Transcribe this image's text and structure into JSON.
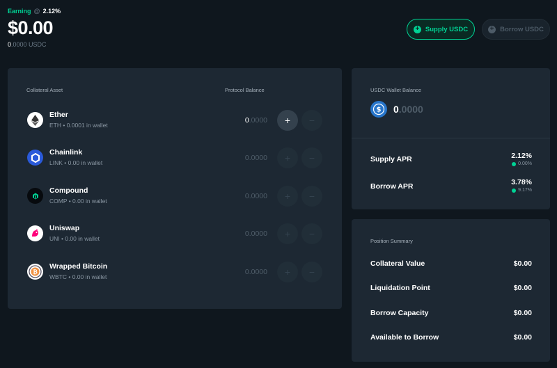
{
  "header": {
    "earning_label": "Earning",
    "earning_at": "@",
    "earning_rate": "2.12%",
    "balance": "$0.00",
    "balance_sub_lead": "0",
    "balance_sub_rest": ".0000 USDC"
  },
  "actions": {
    "supply_label": "Supply USDC",
    "borrow_label": "Borrow USDC"
  },
  "collateral": {
    "col_asset": "Collateral Asset",
    "col_balance": "Protocol Balance",
    "assets": [
      {
        "name": "Ether",
        "sub": "ETH • 0.0001 in wallet",
        "bal_lead": "0",
        "bal_rest": ".0000",
        "color": "#ffffff"
      },
      {
        "name": "Chainlink",
        "sub": "LINK • 0.00 in wallet",
        "bal_lead": "",
        "bal_rest": "0.0000",
        "color": "#2a5ada"
      },
      {
        "name": "Compound",
        "sub": "COMP • 0.00 in wallet",
        "bal_lead": "",
        "bal_rest": "0.0000",
        "color": "#070a0e"
      },
      {
        "name": "Uniswap",
        "sub": "UNI • 0.00 in wallet",
        "bal_lead": "",
        "bal_rest": "0.0000",
        "color": "#ffffff"
      },
      {
        "name": "Wrapped Bitcoin",
        "sub": "WBTC • 0.00 in wallet",
        "bal_lead": "",
        "bal_rest": "0.0000",
        "color": "#ffffff"
      }
    ],
    "plus": "+",
    "minus": "−"
  },
  "wallet": {
    "title": "USDC Wallet Balance",
    "amount_lead": "0",
    "amount_rest": ".0000",
    "supply_apr_label": "Supply APR",
    "supply_apr": "2.12%",
    "supply_comp": "0.00%",
    "borrow_apr_label": "Borrow APR",
    "borrow_apr": "3.78%",
    "borrow_comp": "9.17%"
  },
  "summary": {
    "title": "Position Summary",
    "rows": [
      {
        "label": "Collateral Value",
        "value": "$0.00"
      },
      {
        "label": "Liquidation Point",
        "value": "$0.00"
      },
      {
        "label": "Borrow Capacity",
        "value": "$0.00"
      },
      {
        "label": "Available to Borrow",
        "value": "$0.00"
      }
    ]
  },
  "colors": {
    "accent": "#00d395",
    "background": "#0f171e",
    "panel": "#1d2833",
    "usdc": "#2775ca"
  }
}
